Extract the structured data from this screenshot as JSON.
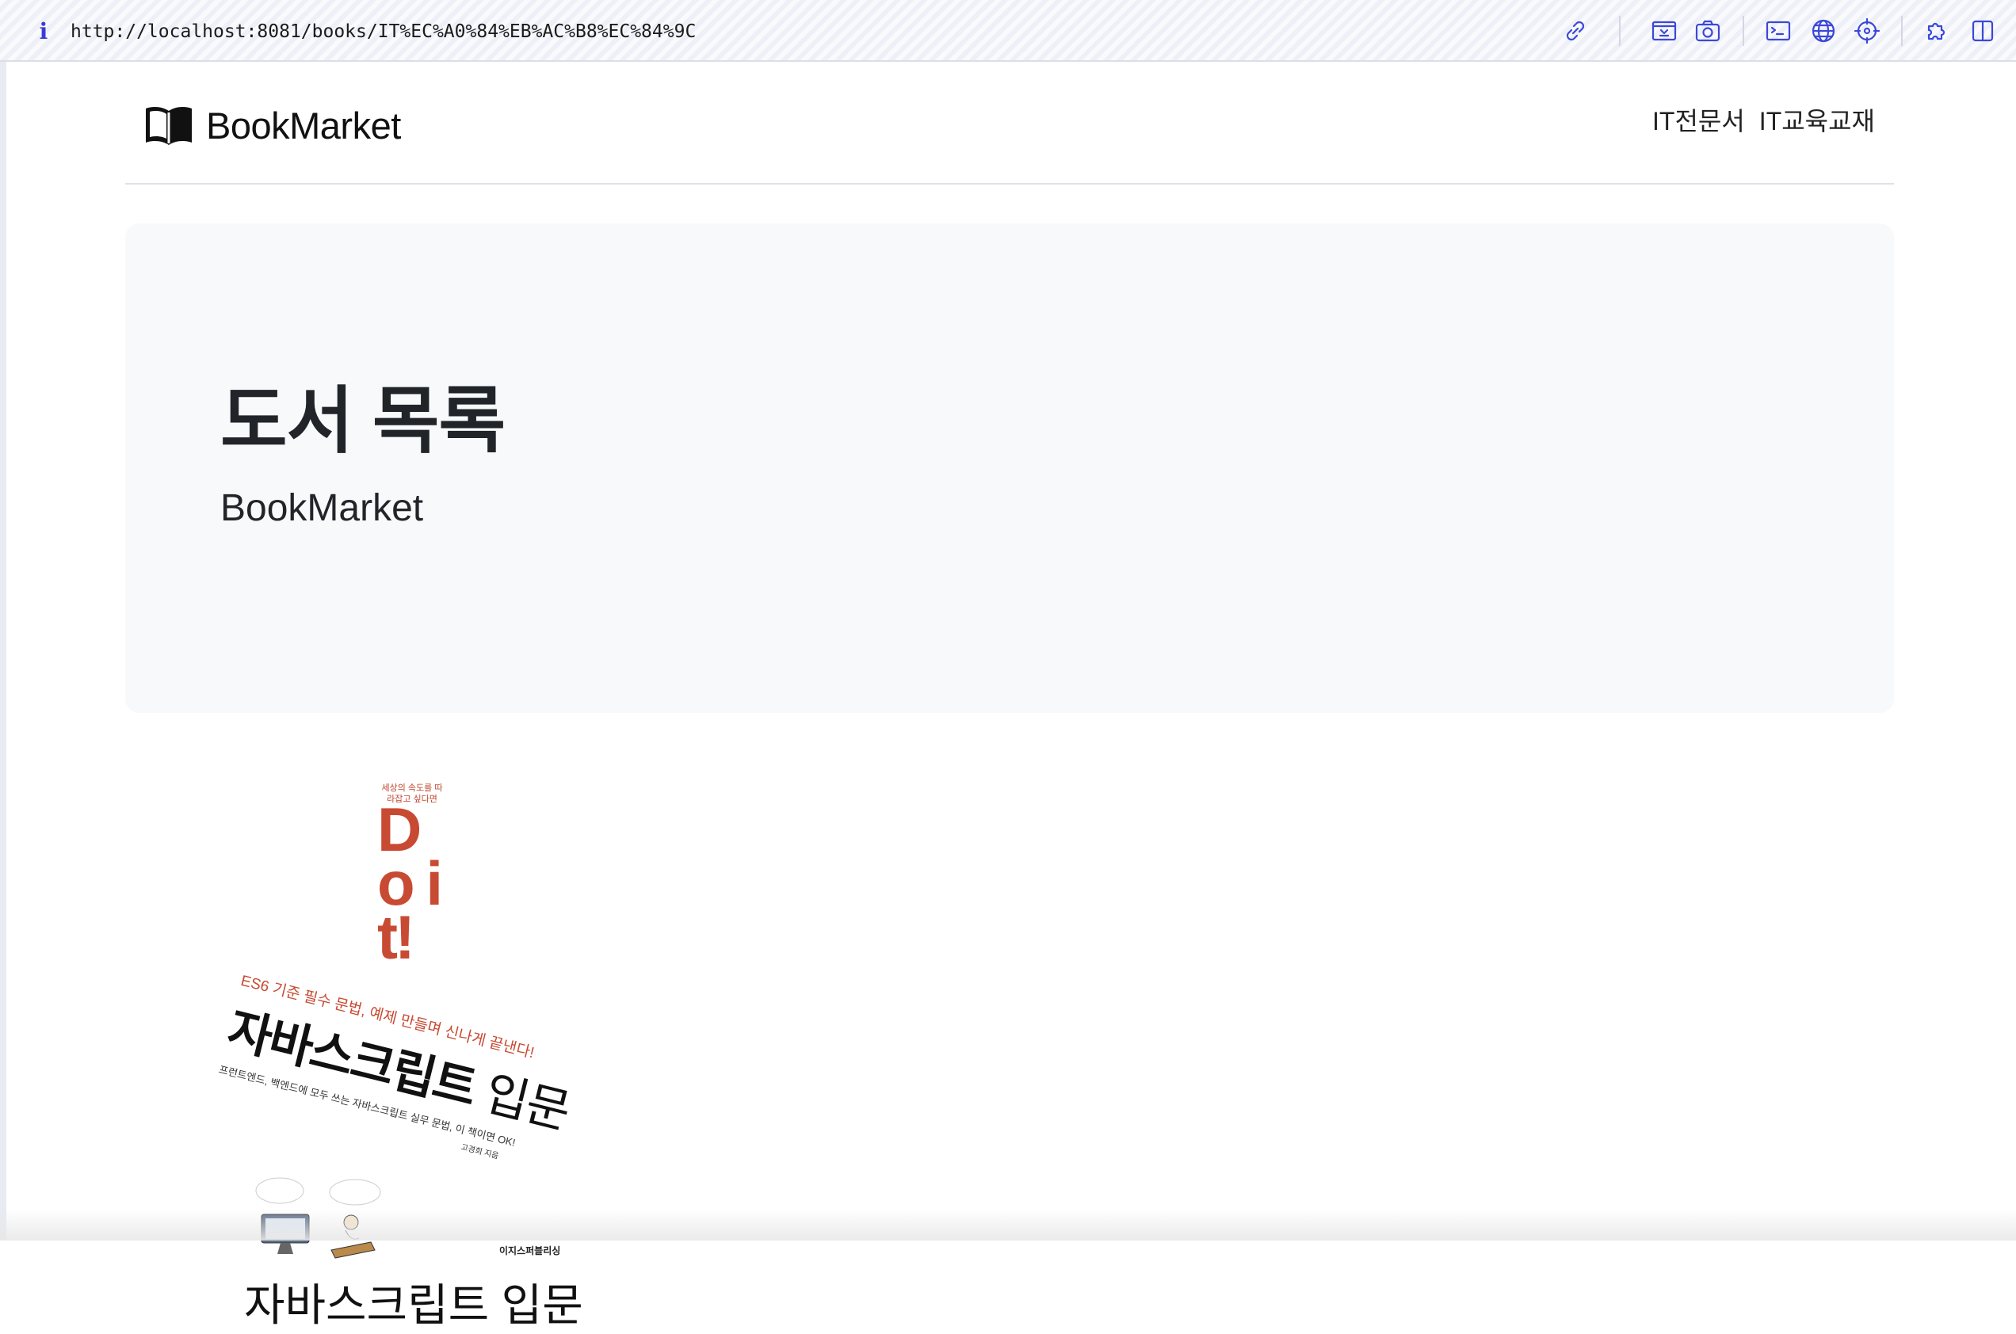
{
  "browser": {
    "info_icon": "i",
    "url": "http://localhost:8081/books/IT%EC%A0%84%EB%AC%B8%EC%84%9C",
    "toolbar_icons": [
      "link-icon",
      "responsive-icon",
      "camera-icon",
      "terminal-icon",
      "globe-icon",
      "crosshair-icon",
      "extension-icon",
      "sidebar-icon"
    ],
    "accent_color": "#3b48d8"
  },
  "header": {
    "brand": "BookMarket",
    "brand_icon": "open-book-icon",
    "nav": [
      {
        "label": "IT전문서"
      },
      {
        "label": "IT교육교재"
      }
    ]
  },
  "jumbotron": {
    "title": "도서 목록",
    "subtitle": "BookMarket"
  },
  "books": [
    {
      "cover": {
        "tagline": "세상의 속도를 따라잡고 싶다면",
        "series": "Do it!",
        "slogan": "ES6 기준 필수 문법, 예제 만들며 신나게 끝낸다!",
        "title_main": "자바스크립트",
        "title_sub": "입문",
        "description": "프런트엔드, 백엔드에 모두 쓰는 자바스크립트 실무 문법, 이 책이면 OK!",
        "author": "고경희 지음",
        "publisher": "이지스퍼블리싱"
      },
      "name": "자바스크립트 입문"
    }
  ]
}
